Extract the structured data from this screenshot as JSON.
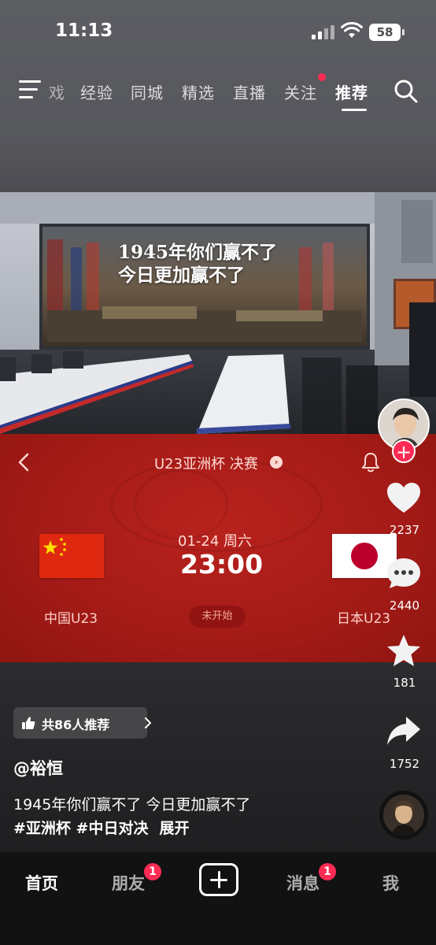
{
  "status_bar": {
    "time": "11:13",
    "battery": "58"
  },
  "top_nav": {
    "tabs": [
      "戏",
      "经验",
      "同城",
      "精选",
      "直播",
      "关注",
      "推荐"
    ],
    "active_tab": "推荐"
  },
  "video": {
    "overlay_lines": [
      "1945年你们赢不了",
      "今日更加赢不了"
    ]
  },
  "match_card": {
    "title": "U23亚洲杯 决赛",
    "date": "01-24 周六",
    "time": "23:00",
    "home_team": "中国U23",
    "away_team": "日本U23",
    "status": "未开始"
  },
  "actions": {
    "likes": "2237",
    "comments": "2440",
    "favorites": "181",
    "shares": "1752",
    "follow_symbol": "+"
  },
  "recommend": {
    "label": "共86人推荐"
  },
  "post": {
    "author": "@裕恒",
    "caption_line1": "1945年你们赢不了 今日更加赢不了",
    "tags": "#亚洲杯 #中日对决",
    "expand": "展开"
  },
  "bottom_nav": {
    "home": "首页",
    "friends": "朋友",
    "friends_badge": "1",
    "messages": "消息",
    "messages_badge": "1",
    "me": "我"
  },
  "colors": {
    "accent": "#ff2b55",
    "card_red": "#a51b17",
    "china_red": "#de2910",
    "japan_red": "#bc002d"
  },
  "icons": [
    "menu-icon",
    "search-icon",
    "back-arrow-icon",
    "bell-icon",
    "heart-icon",
    "comment-icon",
    "star-icon",
    "share-icon",
    "thumb-up-icon",
    "chevron-right-icon",
    "plus-icon"
  ]
}
